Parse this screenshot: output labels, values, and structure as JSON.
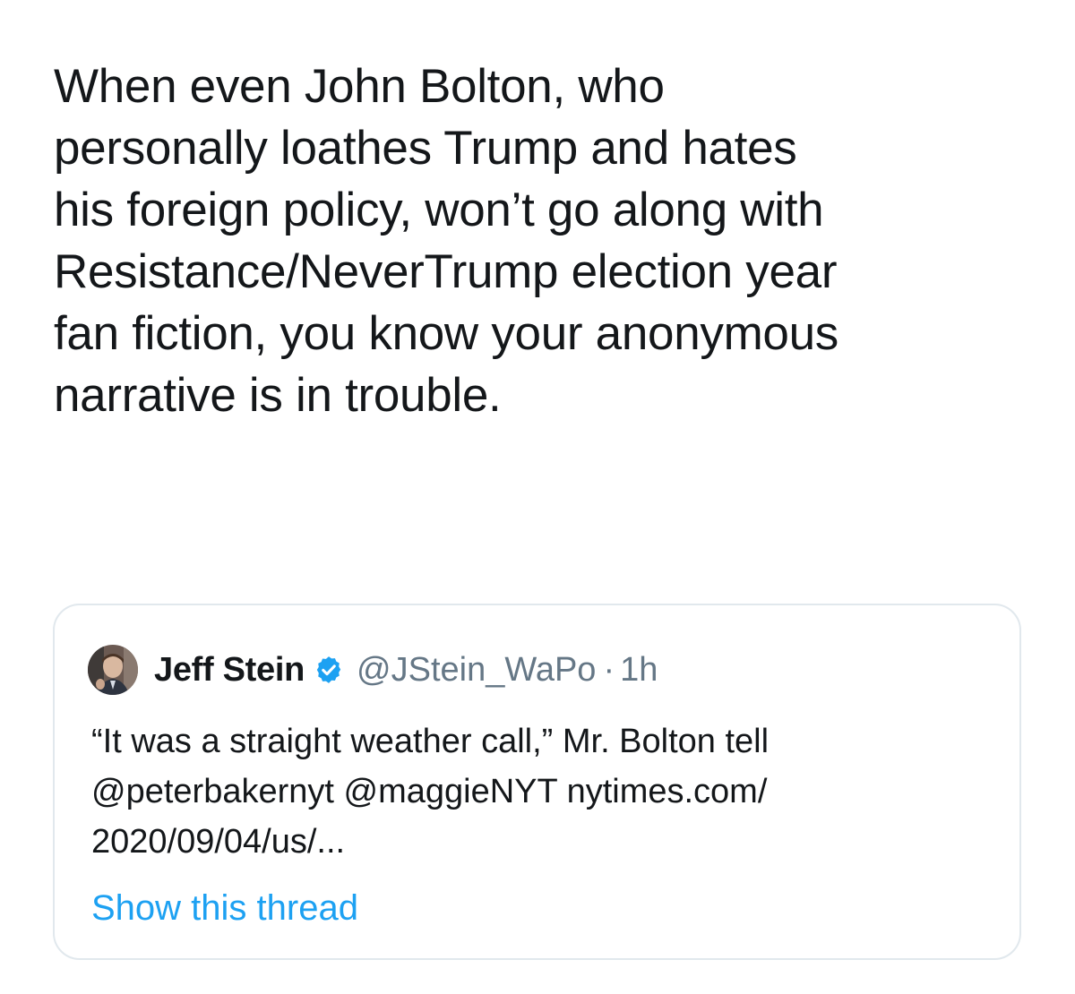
{
  "tweet": {
    "text": "When even John Bolton, who\npersonally loathes Trump and hates\nhis foreign policy, won’t go along with\nResistance/NeverTrump election year\nfan fiction, you know your anonymous\nnarrative is in trouble."
  },
  "quoted_tweet": {
    "author_name": "Jeff Stein",
    "handle": "@JStein_WaPo",
    "separator": "·",
    "time": "1h",
    "text": "“It was a straight weather call,” Mr. Bolton tell\n@peterbakernyt @maggieNYT  nytimes.com/\n2020/09/04/us/...",
    "show_thread_label": "Show this thread",
    "verified_icon": "verified-badge-icon",
    "avatar_icon": "avatar"
  },
  "colors": {
    "text": "#14171a",
    "secondary": "#657786",
    "link": "#1da1f2",
    "border": "#e1e8ed"
  }
}
